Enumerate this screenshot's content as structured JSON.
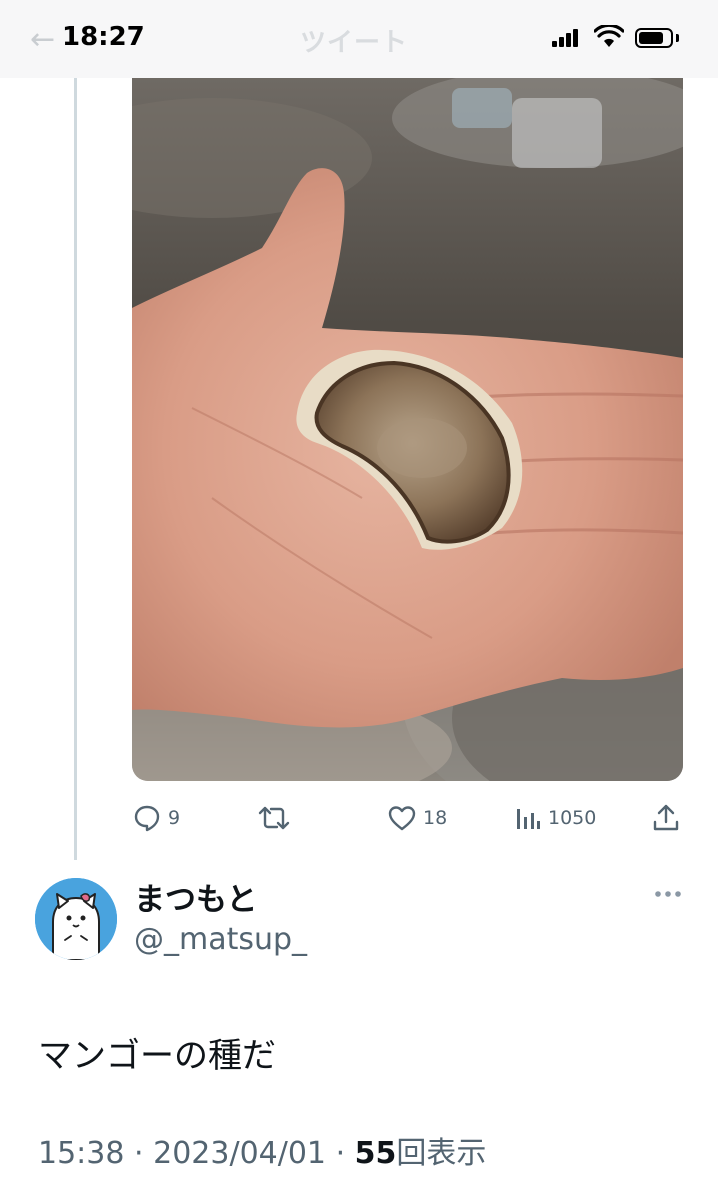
{
  "status_bar": {
    "time": "18:27",
    "header_title": "ツイート",
    "back_icon": "back-arrow-icon",
    "signal_icon": "cellular-signal-icon",
    "wifi_icon": "wifi-icon",
    "battery_icon": "battery-icon"
  },
  "previous_tweet": {
    "media_icon": "photo-mango-seed",
    "actions": {
      "reply_count": "9",
      "retweet_count": "",
      "like_count": "18",
      "view_count": "1050"
    }
  },
  "tweet": {
    "display_name": "まつもと",
    "handle": "@_matsup_",
    "text": "マンゴーの種だ",
    "time": "15:38",
    "separator": "·",
    "date": "2023/04/01",
    "views": "55",
    "views_label": "回表示"
  },
  "colors": {
    "text_primary": "#0f1419",
    "text_secondary": "#536471",
    "thread_line": "#cfd9de",
    "avatar_bg": "#1d9bf0"
  }
}
